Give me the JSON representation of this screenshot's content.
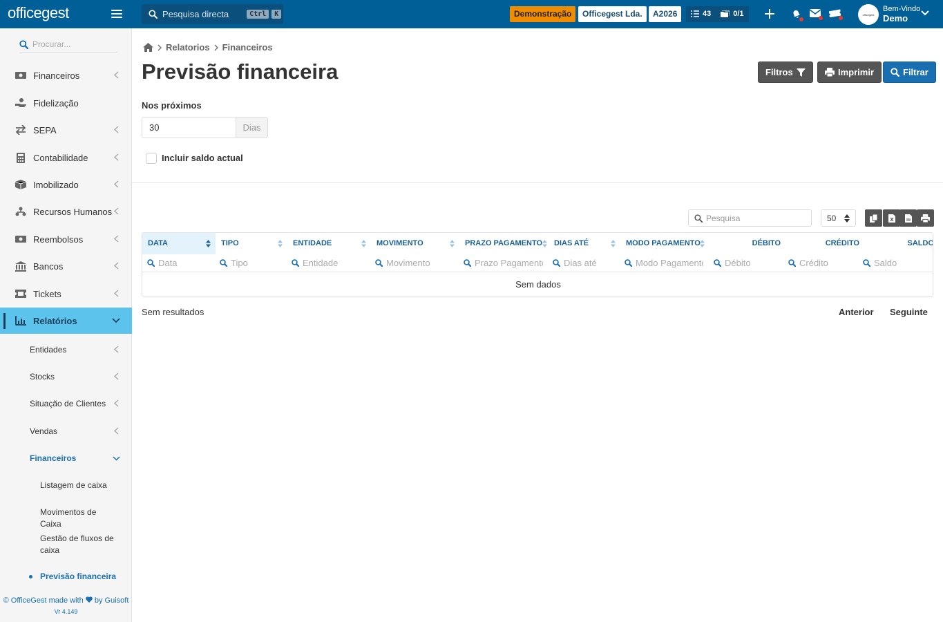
{
  "topbar": {
    "logo": "officegest",
    "search_placeholder": "Pesquisa directa",
    "shortcut_key1": "Ctrl",
    "shortcut_key2": "K",
    "badge_demo": "Demonstração",
    "company": "Officegest Lda.",
    "year": "A2026",
    "tasks_count": "43",
    "docs_count": "0/1",
    "welcome": "Bem-Vindo",
    "user": "Demo",
    "avatar_text": "officegest",
    "colors": {
      "bar": "#005f96",
      "accent": "#f08c00"
    }
  },
  "sidebar": {
    "search_placeholder": "Procurar...",
    "items": [
      {
        "label": "Financeiros",
        "icon": "money-icon"
      },
      {
        "label": "Fidelização",
        "icon": "hand-coin-icon"
      },
      {
        "label": "SEPA",
        "icon": "exchange-icon"
      },
      {
        "label": "Contabilidade",
        "icon": "calculator-icon"
      },
      {
        "label": "Imobilizado",
        "icon": "boxes-icon"
      },
      {
        "label": "Recursos Humanos",
        "icon": "sitemap-icon"
      },
      {
        "label": "Reembolsos",
        "icon": "money-icon"
      },
      {
        "label": "Bancos",
        "icon": "bank-icon"
      },
      {
        "label": "Tickets",
        "icon": "ticket-icon"
      },
      {
        "label": "Relatórios",
        "icon": "chart-icon"
      }
    ],
    "report_items": [
      {
        "label": "Entidades"
      },
      {
        "label": "Stocks"
      },
      {
        "label": "Situação de Clientes"
      },
      {
        "label": "Vendas"
      },
      {
        "label": "Financeiros"
      }
    ],
    "finance_items": [
      {
        "label": "Listagem de caixa"
      },
      {
        "label": "Movimentos de Caixa"
      },
      {
        "label": "Gestão de fluxos de caixa"
      },
      {
        "label": "Previsão financeira"
      }
    ],
    "footer": {
      "made_prefix": "© OfficeGest made with",
      "made_suffix": "by Guisoft",
      "version": "Vr 4.149"
    }
  },
  "breadcrumb": {
    "level1": "Relatorios",
    "level2": "Financeiros"
  },
  "page": {
    "title": "Previsão financeira",
    "btn_filters": "Filtros",
    "btn_print": "Imprimir",
    "btn_filter": "Filtrar"
  },
  "form": {
    "next_label": "Nos próximos",
    "days_value": "30",
    "days_addon": "Dias",
    "include_balance": "Incluir saldo actual"
  },
  "table": {
    "search_placeholder": "Pesquisa",
    "page_size": "50",
    "columns": [
      {
        "header": "DATA",
        "filter": "Data"
      },
      {
        "header": "TIPO",
        "filter": "Tipo"
      },
      {
        "header": "ENTIDADE",
        "filter": "Entidade"
      },
      {
        "header": "MOVIMENTO",
        "filter": "Movimento"
      },
      {
        "header": "PRAZO PAGAMENTO",
        "filter": "Prazo Pagamento"
      },
      {
        "header": "DIAS ATÉ",
        "filter": "Dias até"
      },
      {
        "header": "MODO PAGAMENTO",
        "filter": "Modo Pagamento"
      },
      {
        "header": "DÉBITO",
        "filter": "Débito"
      },
      {
        "header": "CRÉDITO",
        "filter": "Crédito"
      },
      {
        "header": "SALDO",
        "filter": "Saldo"
      }
    ],
    "empty": "Sem dados",
    "no_results": "Sem resultados",
    "prev": "Anterior",
    "next": "Seguinte"
  }
}
